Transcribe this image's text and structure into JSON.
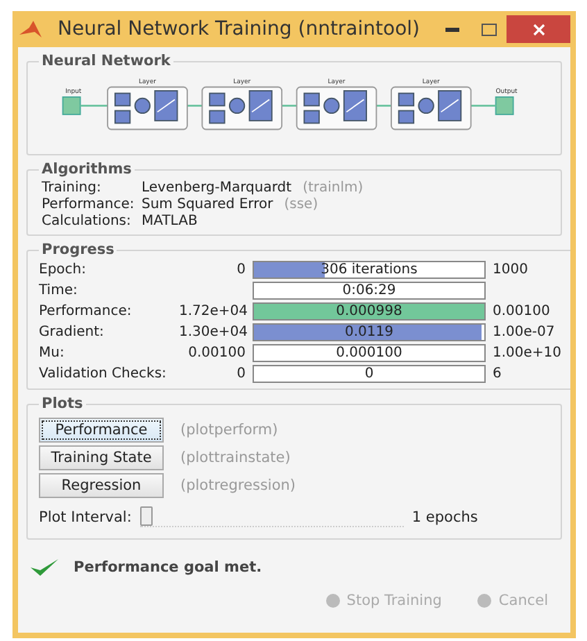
{
  "window": {
    "title": "Neural Network Training (nntraintool)"
  },
  "network": {
    "title": "Neural Network",
    "input_label": "Input",
    "output_label": "Output",
    "layers": [
      {
        "label": "Layer"
      },
      {
        "label": "Layer"
      },
      {
        "label": "Layer"
      },
      {
        "label": "Layer"
      }
    ]
  },
  "algorithms": {
    "title": "Algorithms",
    "rows": [
      {
        "label": "Training:",
        "value": "Levenberg-Marquardt",
        "code": "(trainlm)"
      },
      {
        "label": "Performance:",
        "value": "Sum Squared Error",
        "code": "(sse)"
      },
      {
        "label": "Calculations:",
        "value": "MATLAB"
      }
    ]
  },
  "progress": {
    "title": "Progress",
    "rows": [
      {
        "label": "Epoch:",
        "min": "0",
        "reading": "306 iterations",
        "level": 0.306,
        "color": "#7b8fd0",
        "max": "1000"
      },
      {
        "label": "Time:",
        "reading": "0:06:29"
      },
      {
        "label": "Performance:",
        "min": "1.72e+04",
        "reading": "0.000998",
        "level": 1,
        "color": "#72c79a",
        "max": "0.00100"
      },
      {
        "label": "Gradient:",
        "min": "1.30e+04",
        "reading": "0.0119",
        "level": 0.985,
        "color": "#7b8fd0",
        "max": "1.00e-07"
      },
      {
        "label": "Mu:",
        "min": "0.00100",
        "reading": "0.000100",
        "max": "1.00e+10"
      },
      {
        "label": "Validation Checks:",
        "min": "0",
        "reading": "0",
        "max": "6"
      }
    ]
  },
  "plots": {
    "title": "Plots",
    "buttons": [
      {
        "label": "Performance",
        "code": "(plotperform)",
        "focused": true
      },
      {
        "label": "Training State",
        "code": "(plottrainstate)",
        "focused": false
      },
      {
        "label": "Regression",
        "code": "(plotregression)",
        "focused": false
      }
    ],
    "interval": {
      "label": "Plot Interval:",
      "level": 0,
      "reading": "1 epochs"
    }
  },
  "status": {
    "message": "Performance goal met."
  },
  "actions": [
    {
      "label": "Stop Training",
      "disabled": true
    },
    {
      "label": "Cancel",
      "disabled": true
    }
  ]
}
